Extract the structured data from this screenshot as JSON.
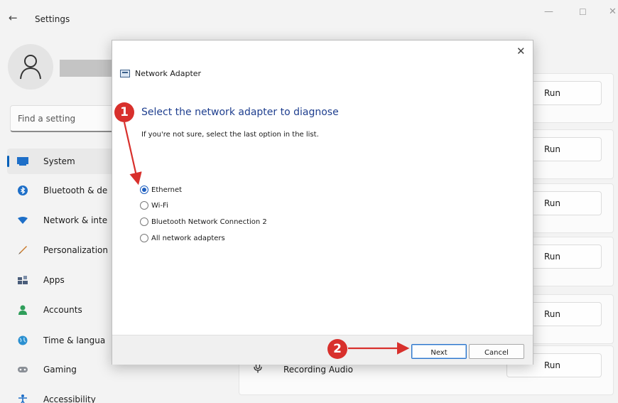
{
  "window": {
    "back_glyph": "←",
    "title": "Settings",
    "minimize_glyph": "—",
    "maximize_glyph": "☐",
    "close_glyph": "✕"
  },
  "search": {
    "placeholder": "Find a setting"
  },
  "sidebar": {
    "items": [
      {
        "label": "System",
        "icon": "system-icon",
        "active": true
      },
      {
        "label": "Bluetooth & de",
        "icon": "bluetooth-icon"
      },
      {
        "label": "Network & inte",
        "icon": "wifi-icon"
      },
      {
        "label": "Personalization",
        "icon": "brush-icon"
      },
      {
        "label": "Apps",
        "icon": "apps-icon"
      },
      {
        "label": "Accounts",
        "icon": "person-icon"
      },
      {
        "label": "Time & langua",
        "icon": "globe-icon"
      },
      {
        "label": "Gaming",
        "icon": "gamepad-icon"
      },
      {
        "label": "Accessibility",
        "icon": "accessibility-icon"
      }
    ]
  },
  "troubleshooters": {
    "run_label": "Run",
    "recording_label": "Recording Audio"
  },
  "dialog": {
    "close_glyph": "✕",
    "app_title": "Network Adapter",
    "heading": "Select the network adapter to diagnose",
    "hint": "If you're not sure, select the last option in the list.",
    "options": [
      {
        "label": "Ethernet",
        "selected": true
      },
      {
        "label": "Wi-Fi",
        "selected": false
      },
      {
        "label": "Bluetooth Network Connection 2",
        "selected": false
      },
      {
        "label": "All network adapters",
        "selected": false
      }
    ],
    "next_label": "Next",
    "cancel_label": "Cancel"
  },
  "annotations": {
    "step1": "1",
    "step2": "2",
    "color": "#d8302c"
  },
  "colors": {
    "accent": "#005fb8",
    "heading_blue": "#1f3f8f"
  }
}
